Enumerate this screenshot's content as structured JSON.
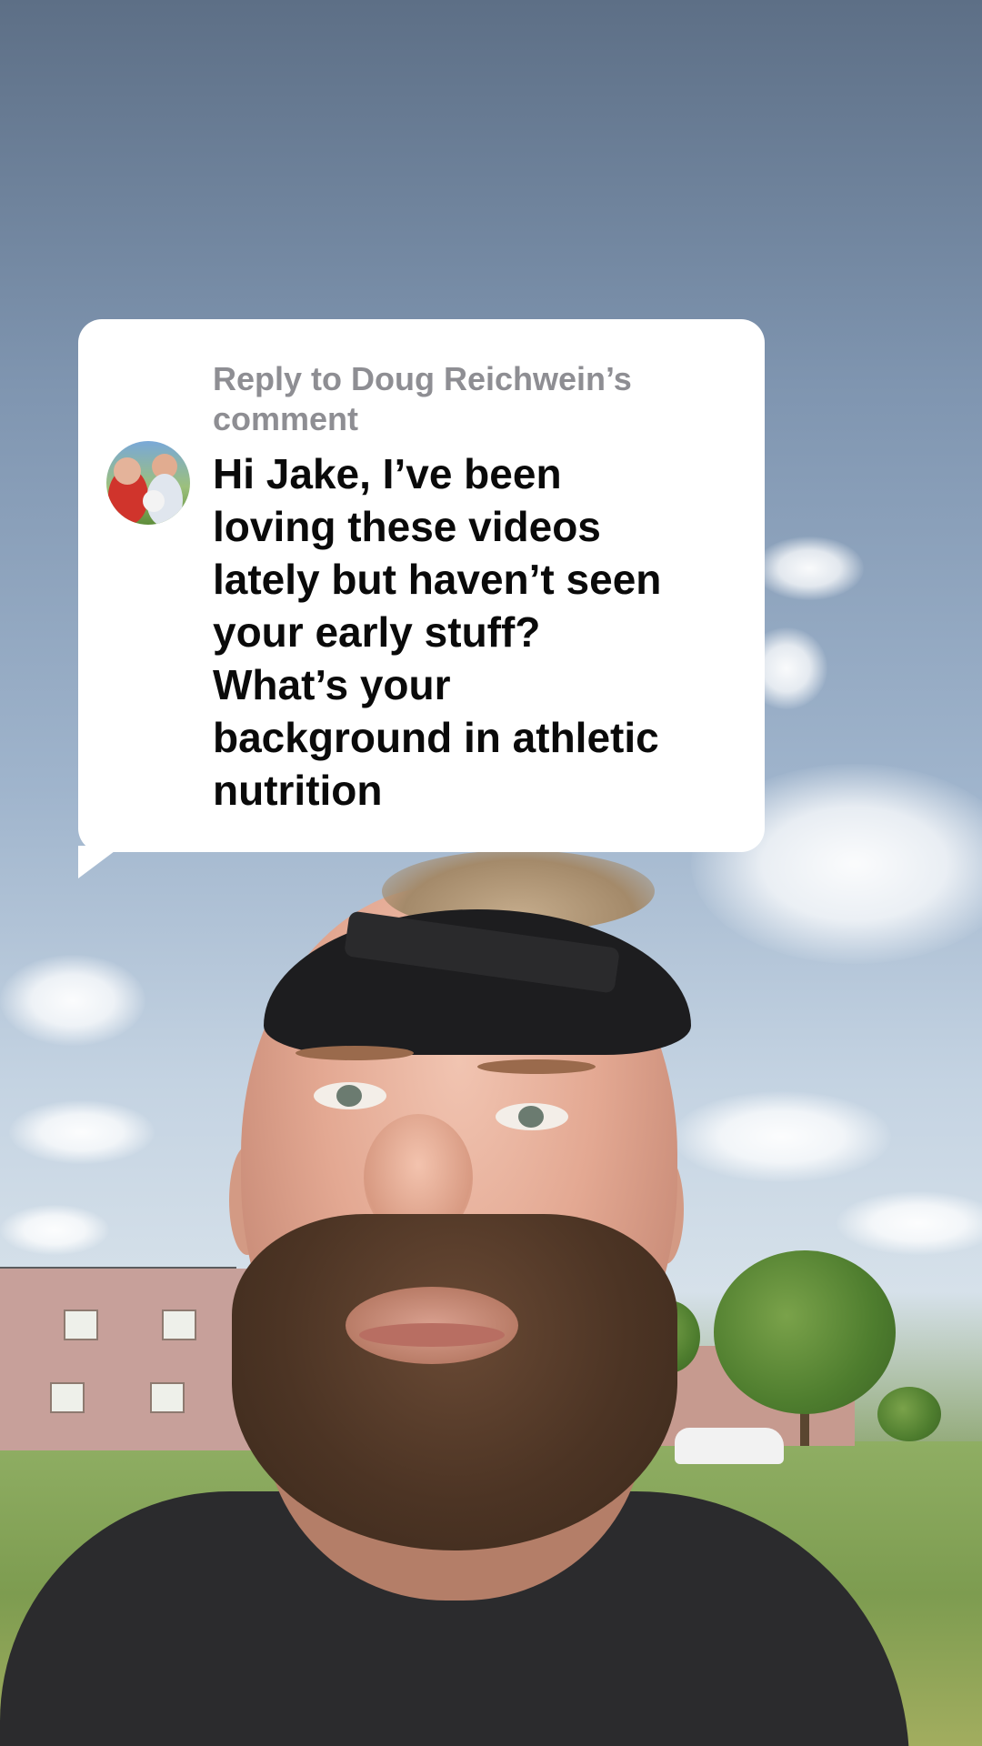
{
  "comment_reply": {
    "reply_label": "Reply to Doug Reichwein’s\ncomment",
    "comment_text": "Hi Jake, I’ve been\nloving these videos\nlately but haven’t seen\nyour early stuff?\nWhat’s your\nbackground in athletic\nnutrition",
    "avatar_icon": "profile-avatar-icon"
  },
  "colors": {
    "bubble_background": "#ffffff",
    "reply_label": "#8e8e93",
    "comment_text": "#0a0a0a"
  }
}
